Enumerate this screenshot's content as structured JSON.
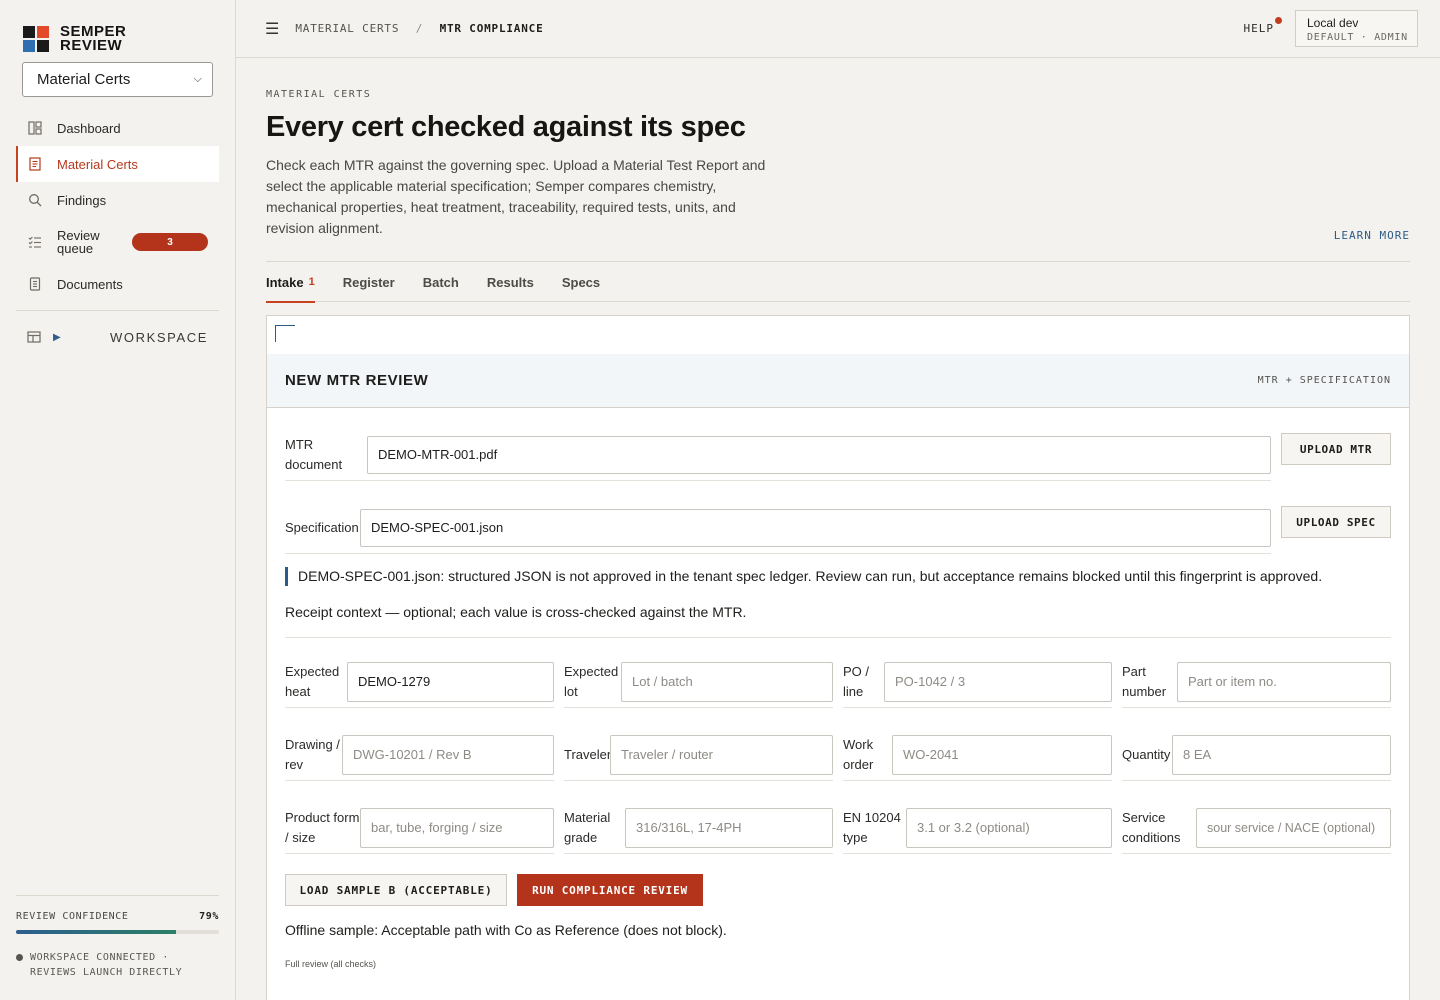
{
  "brand": {
    "line1": "SEMPER",
    "line2": "REVIEW",
    "colors": [
      "#1a1a1a",
      "#e3492a",
      "#2f6fb1",
      "#1a1a1a"
    ]
  },
  "workspace_select": {
    "value": "Material Certs"
  },
  "nav": [
    {
      "label": "Dashboard",
      "icon": "dashboard-icon"
    },
    {
      "label": "Material Certs",
      "icon": "document-icon",
      "active": true
    },
    {
      "label": "Findings",
      "icon": "search-icon"
    },
    {
      "label": "Review queue",
      "icon": "checklist-icon",
      "badge": "3"
    },
    {
      "label": "Documents",
      "icon": "file-icon"
    }
  ],
  "workspace_section": {
    "label": "WORKSPACE"
  },
  "confidence": {
    "label": "REVIEW CONFIDENCE",
    "value": "79%",
    "fraction": 0.79,
    "status": "WORKSPACE CONNECTED · REVIEWS LAUNCH DIRECTLY"
  },
  "topbar": {
    "crumb1": "MATERIAL CERTS",
    "sep": "/",
    "crumb2": "MTR COMPLIANCE",
    "help": "HELP",
    "env_title": "Local dev",
    "env_sub": "DEFAULT · ADMIN"
  },
  "page": {
    "eyebrow": "MATERIAL CERTS",
    "title": "Every cert checked against its spec",
    "lead": "Check each MTR against the governing spec. Upload a Material Test Report and select the applicable material specification; Semper compares chemistry, mechanical properties, heat treatment, traceability, required tests, units, and revision alignment.",
    "learn_more": "LEARN MORE"
  },
  "tabs": [
    {
      "label": "Intake",
      "count": "1",
      "active": true
    },
    {
      "label": "Register"
    },
    {
      "label": "Batch"
    },
    {
      "label": "Results"
    },
    {
      "label": "Specs"
    }
  ],
  "panel": {
    "title": "NEW MTR REVIEW",
    "subtitle": "MTR + SPECIFICATION",
    "mtr_label": "MTR document",
    "mtr_value": "DEMO-MTR-001.pdf",
    "upload_mtr": "UPLOAD MTR",
    "spec_label": "Specification",
    "spec_value": "DEMO-SPEC-001.json",
    "upload_spec": "UPLOAD SPEC",
    "note": "DEMO-SPEC-001.json: structured JSON is not approved in the tenant spec ledger. Review can run, but acceptance remains blocked until this fingerprint is approved.",
    "receipt": "Receipt context — optional; each value is cross-checked against the MTR.",
    "fields": [
      {
        "label": "Expected heat",
        "value": "DEMO-1279",
        "placeholder": ""
      },
      {
        "label": "Expected lot",
        "value": "",
        "placeholder": "Lot / batch"
      },
      {
        "label": "PO / line",
        "value": "",
        "placeholder": "PO-1042 / 3"
      },
      {
        "label": "Part number",
        "value": "",
        "placeholder": "Part or item no."
      },
      {
        "label": "Drawing / rev",
        "value": "",
        "placeholder": "DWG-10201 / Rev B"
      },
      {
        "label": "Traveler",
        "value": "",
        "placeholder": "Traveler / router"
      },
      {
        "label": "Work order",
        "value": "",
        "placeholder": "WO-2041"
      },
      {
        "label": "Quantity",
        "value": "",
        "placeholder": "8 EA"
      },
      {
        "label": "Product form / size",
        "value": "",
        "placeholder": "bar, tube, forging / size"
      },
      {
        "label": "Material grade",
        "value": "",
        "placeholder": "316/316L, 17-4PH"
      },
      {
        "label": "EN 10204 type",
        "value": "",
        "placeholder": "3.1 or 3.2 (optional)"
      },
      {
        "label": "Service conditions",
        "value": "",
        "placeholder": "sour service / NACE (optional)"
      }
    ],
    "btn_sample": "LOAD SAMPLE B (ACCEPTABLE)",
    "btn_run": "RUN COMPLIANCE REVIEW",
    "offline": "Offline sample: Acceptable path with Co as Reference (does not block).",
    "full_review": "Full review (all checks)"
  },
  "accent": "#b3341a"
}
